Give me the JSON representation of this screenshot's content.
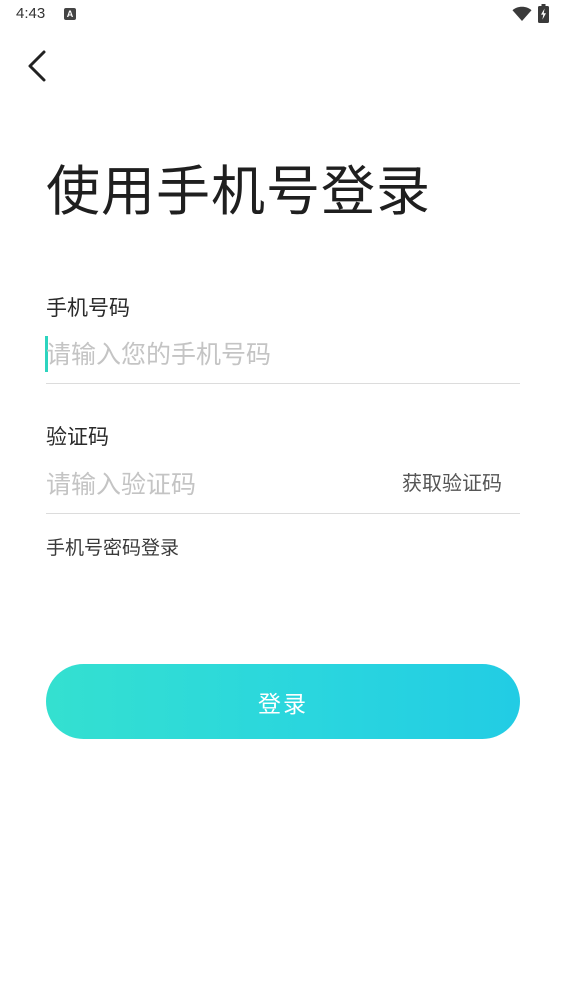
{
  "status_bar": {
    "time": "4:43",
    "notification_badge": "A",
    "icons": [
      "wifi-icon",
      "battery-charging-icon"
    ]
  },
  "header": {
    "back_icon": "chevron-left-icon"
  },
  "title": "使用手机号登录",
  "phone_field": {
    "label": "手机号码",
    "value": "",
    "placeholder": "请输入您的手机号码"
  },
  "code_field": {
    "label": "验证码",
    "value": "",
    "placeholder": "请输入验证码",
    "get_code_label": "获取验证码"
  },
  "password_login_link": "手机号密码登录",
  "login_button": {
    "label": "登录"
  },
  "colors": {
    "accent_start": "#34e0d0",
    "accent_end": "#22cce4",
    "cursor": "#2dd4bf",
    "placeholder": "#c4c4c4",
    "divider": "#dcdcdc"
  }
}
